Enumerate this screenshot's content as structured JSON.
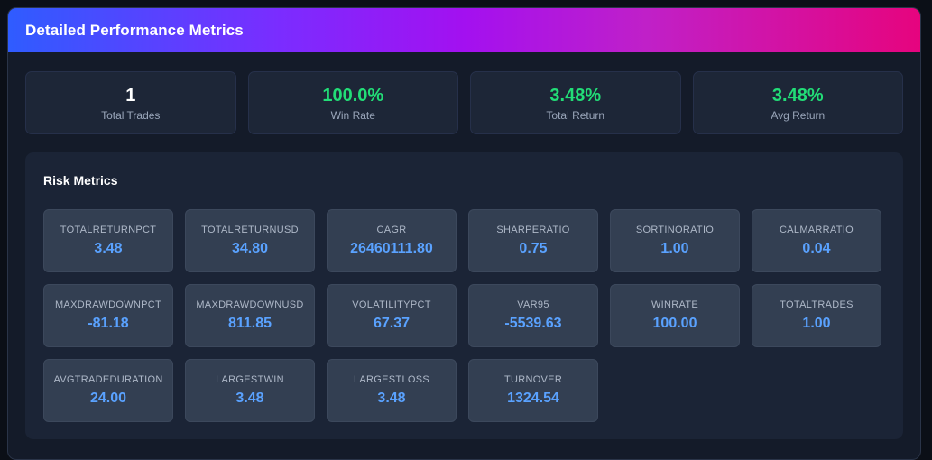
{
  "header": {
    "title": "Detailed Performance Metrics"
  },
  "summary": [
    {
      "value": "1",
      "label": "Total Trades",
      "color": "#ffffff"
    },
    {
      "value": "100.0%",
      "label": "Win Rate",
      "color": "#22dd77"
    },
    {
      "value": "3.48%",
      "label": "Total Return",
      "color": "#22dd77"
    },
    {
      "value": "3.48%",
      "label": "Avg Return",
      "color": "#22dd77"
    }
  ],
  "risk": {
    "title": "Risk Metrics",
    "metrics": [
      {
        "label": "TOTALRETURNPCT",
        "value": "3.48"
      },
      {
        "label": "TOTALRETURNUSD",
        "value": "34.80"
      },
      {
        "label": "CAGR",
        "value": "26460111.80"
      },
      {
        "label": "SHARPERATIO",
        "value": "0.75"
      },
      {
        "label": "SORTINORATIO",
        "value": "1.00"
      },
      {
        "label": "CALMARRATIO",
        "value": "0.04"
      },
      {
        "label": "MAXDRAWDOWNPCT",
        "value": "-81.18"
      },
      {
        "label": "MAXDRAWDOWNUSD",
        "value": "811.85"
      },
      {
        "label": "VOLATILITYPCT",
        "value": "67.37"
      },
      {
        "label": "VAR95",
        "value": "-5539.63"
      },
      {
        "label": "WINRATE",
        "value": "100.00"
      },
      {
        "label": "TOTALTRADES",
        "value": "1.00"
      },
      {
        "label": "AVGTRADEDURATION",
        "value": "24.00"
      },
      {
        "label": "LARGESTWIN",
        "value": "3.48"
      },
      {
        "label": "LARGESTLOSS",
        "value": "3.48"
      },
      {
        "label": "TURNOVER",
        "value": "1324.54"
      }
    ]
  },
  "colors": {
    "accent_green": "#22dd77",
    "metric_blue": "#5aa2ff",
    "header_gradient_start": "#2f5cff",
    "header_gradient_end": "#e6047e"
  }
}
